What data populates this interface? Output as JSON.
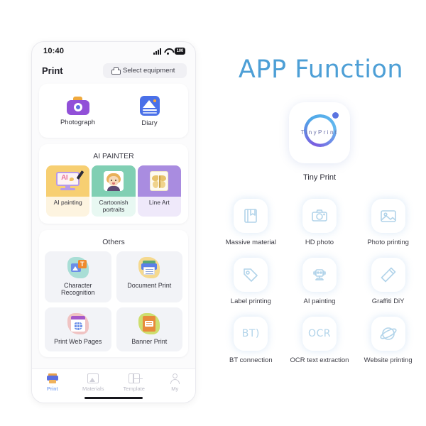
{
  "right_panel": {
    "title": "APP Function",
    "title_color": "#4d9fd6",
    "logo": {
      "wordmark": "TinyPrint",
      "name": "Tiny Print"
    },
    "features": [
      {
        "label": "Massive material",
        "icon": "book-bookmark-icon"
      },
      {
        "label": "HD photo",
        "icon": "camera-icon"
      },
      {
        "label": "Photo printing",
        "icon": "image-icon"
      },
      {
        "label": "Label printing",
        "icon": "tag-icon"
      },
      {
        "label": "AI painting",
        "icon": "robot-icon"
      },
      {
        "label": "Graffiti DiY",
        "icon": "pencil-icon"
      },
      {
        "label": "BT connection",
        "icon": "bluetooth-text-icon",
        "text": "BT)"
      },
      {
        "label": "OCR text extraction",
        "icon": "ocr-text-icon",
        "text": "OCR"
      },
      {
        "label": "Website printing",
        "icon": "planet-icon"
      }
    ]
  },
  "phone": {
    "status_bar": {
      "time": "10:40",
      "signal_icon": "signal-bars-icon",
      "wifi_icon": "wifi-icon",
      "battery_level": "100"
    },
    "header": {
      "title": "Print",
      "select_equipment_label": "Select equipment",
      "printer_icon": "printer-icon"
    },
    "quick_tiles": [
      {
        "label": "Photograph",
        "icon": "camera-icon"
      },
      {
        "label": "Diary",
        "icon": "photo-diary-icon"
      }
    ],
    "ai_painter": {
      "section_title": "AI PAINTER",
      "items": [
        {
          "label": "AI painting",
          "icon": "monitor-ai-icon",
          "color": "#f7cf72"
        },
        {
          "label": "Cartoonish portraits",
          "icon": "portrait-icon",
          "color": "#80cfb3"
        },
        {
          "label": "Line Art",
          "icon": "butterfly-icon",
          "color": "#a98ce0"
        }
      ]
    },
    "others": {
      "section_title": "Others",
      "items": [
        {
          "label": "Character Recognition",
          "icon": "image-text-icon",
          "color": "#a9ded6"
        },
        {
          "label": "Document Print",
          "icon": "document-printer-icon",
          "color": "#f5d98f"
        },
        {
          "label": "Print Web Pages",
          "icon": "browser-globe-icon",
          "color": "#f0c3c3"
        },
        {
          "label": "Banner Print",
          "icon": "banner-icon",
          "color": "#cede6e"
        }
      ]
    },
    "tabs": [
      {
        "label": "Print",
        "icon": "printer-icon",
        "active": true
      },
      {
        "label": "Materials",
        "icon": "gallery-icon",
        "active": false
      },
      {
        "label": "Template",
        "icon": "layout-icon",
        "active": false
      },
      {
        "label": "My",
        "icon": "user-icon",
        "active": false
      }
    ]
  }
}
